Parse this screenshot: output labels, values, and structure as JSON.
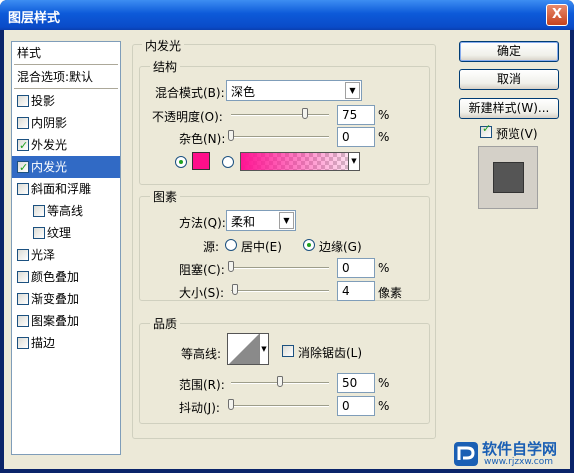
{
  "window": {
    "title": "图层样式",
    "close": "X"
  },
  "styles_list": {
    "header": "样式",
    "blend_options": "混合选项:默认",
    "items": [
      {
        "label": "投影",
        "checked": false
      },
      {
        "label": "内阴影",
        "checked": false
      },
      {
        "label": "外发光",
        "checked": true
      },
      {
        "label": "内发光",
        "checked": true
      },
      {
        "label": "斜面和浮雕",
        "checked": false
      },
      {
        "label": "等高线",
        "checked": false
      },
      {
        "label": "纹理",
        "checked": false
      },
      {
        "label": "光泽",
        "checked": false
      },
      {
        "label": "颜色叠加",
        "checked": false
      },
      {
        "label": "渐变叠加",
        "checked": false
      },
      {
        "label": "图案叠加",
        "checked": false
      },
      {
        "label": "描边",
        "checked": false
      }
    ]
  },
  "panel": {
    "title": "内发光",
    "structure": {
      "title": "结构",
      "blend_mode_label": "混合模式(B):",
      "blend_mode_value": "深色",
      "opacity_label": "不透明度(O):",
      "opacity_value": "75",
      "opacity_unit": "%",
      "opacity_level": 75,
      "noise_label": "杂色(N):",
      "noise_value": "0",
      "noise_unit": "%",
      "color": "#ff0f8a"
    },
    "elements": {
      "title": "图素",
      "method_label": "方法(Q):",
      "method_value": "柔和",
      "source_label": "源:",
      "source_center": "居中(E)",
      "source_edge": "边缘(G)",
      "choke_label": "阻塞(C):",
      "choke_value": "0",
      "choke_unit": "%",
      "size_label": "大小(S):",
      "size_value": "4",
      "size_unit": "像素"
    },
    "quality": {
      "title": "品质",
      "contour_label": "等高线:",
      "antialias_label": "消除锯齿(L)",
      "range_label": "范围(R):",
      "range_value": "50",
      "range_unit": "%",
      "range_level": 50,
      "jitter_label": "抖动(J):",
      "jitter_value": "0",
      "jitter_unit": "%"
    }
  },
  "buttons": {
    "ok": "确定",
    "cancel": "取消",
    "new_style": "新建样式(W)...",
    "preview_label": "预览(V)"
  },
  "watermark": {
    "brand": "软件自学网",
    "url": "www.rjzxw.com"
  }
}
